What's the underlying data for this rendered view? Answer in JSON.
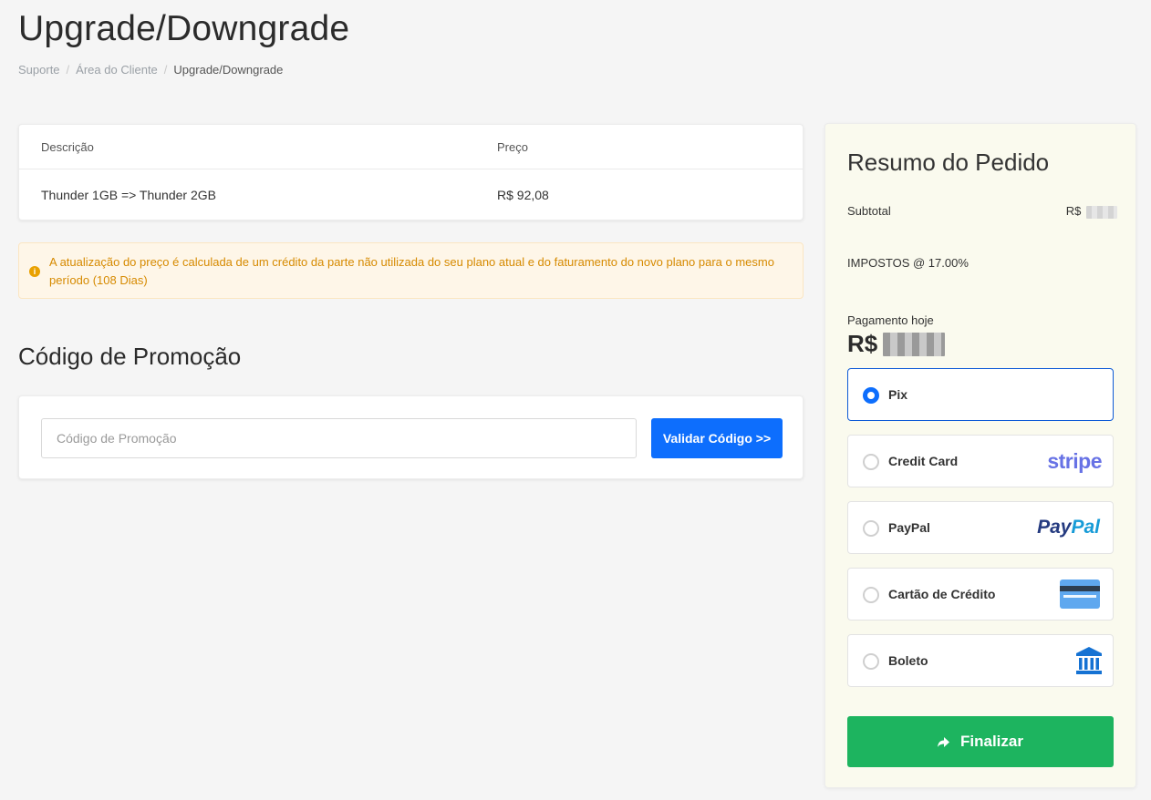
{
  "page": {
    "title": "Upgrade/Downgrade"
  },
  "breadcrumb": [
    "Suporte",
    "Área do Cliente",
    "Upgrade/Downgrade"
  ],
  "items_table": {
    "headers": [
      "Descrição",
      "Preço"
    ],
    "rows": [
      {
        "description": "Thunder 1GB => Thunder 2GB",
        "price": "R$ 92,08"
      }
    ]
  },
  "alert": {
    "text": "A atualização do preço é calculada de um crédito da parte não utilizada do seu plano atual e do faturamento do novo plano para o mesmo período (108 Dias)",
    "color": "#d68a00"
  },
  "promo": {
    "title": "Código de Promoção",
    "placeholder": "Código de Promoção",
    "value": "",
    "button_label": "Validar Código >>"
  },
  "summary": {
    "title": "Resumo do Pedido",
    "subtotal_label": "Subtotal",
    "currency": "R$",
    "tax_label": "IMPOSTOS @ 17.00%",
    "pay_today_label": "Pagamento hoje",
    "payment_methods": [
      {
        "label": "Pix",
        "selected": true,
        "logo": ""
      },
      {
        "label": "Credit Card",
        "selected": false,
        "logo": "stripe-logo"
      },
      {
        "label": "PayPal",
        "selected": false,
        "logo": "paypal-logo"
      },
      {
        "label": "Cartão de Crédito",
        "selected": false,
        "logo": "credit-card-icon"
      },
      {
        "label": "Boleto",
        "selected": false,
        "logo": "bank-icon"
      }
    ],
    "stripe_text": "stripe",
    "paypal_text": {
      "pay": "Pay",
      "pal": "Pal"
    },
    "finalize_label": "Finalizar"
  },
  "colors": {
    "primary": "#0d6efd",
    "success": "#1db45f",
    "summary_bg": "#fafaee",
    "alert_bg": "#fef6e8"
  }
}
